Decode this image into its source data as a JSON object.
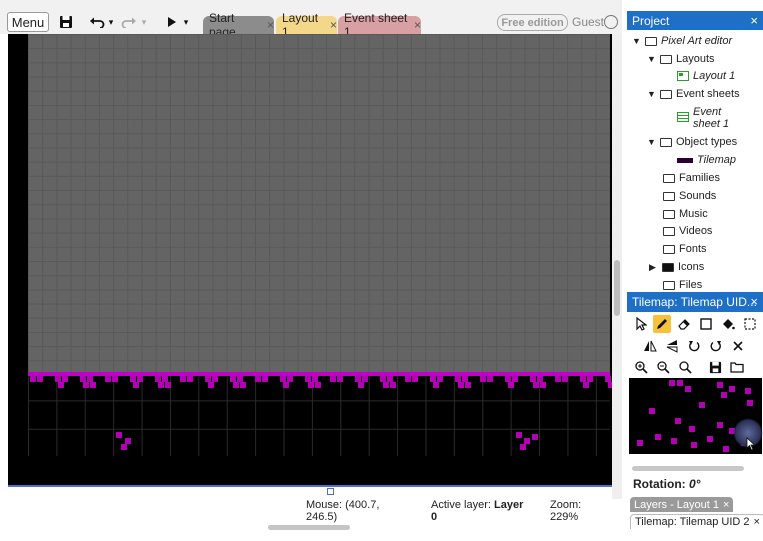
{
  "toolbar": {
    "menu_label": "Menu",
    "save_icon": "save-icon",
    "undo_icon": "undo-icon",
    "redo_icon": "redo-icon",
    "play_icon": "play-icon",
    "dropdown_glyph": "▾",
    "tabs": [
      {
        "label": "Start page",
        "close": "×",
        "color": "#8c8c8c"
      },
      {
        "label": "Layout 1",
        "close": "×",
        "color": "#f3d78a"
      },
      {
        "label": "Event sheet 1",
        "close": "×",
        "color": "#d9a0a4"
      }
    ],
    "edition_badge": "Free edition",
    "user": "Guest"
  },
  "status": {
    "mouse": "Mouse: (400.7, 246.5)",
    "active_layer_label": "Active layer:",
    "active_layer_value": "Layer 0",
    "zoom": "Zoom: 229%"
  },
  "project_panel": {
    "title": "Project",
    "close": "×",
    "tree": [
      {
        "label": "Pixel Art editor",
        "expanded": true,
        "italic": true
      },
      {
        "label": "Layouts",
        "expanded": true
      },
      {
        "label": "Layout 1",
        "italic": true
      },
      {
        "label": "Event sheets",
        "expanded": true
      },
      {
        "label": "Event sheet 1",
        "italic": true
      },
      {
        "label": "Object types",
        "expanded": true
      },
      {
        "label": "Tilemap",
        "italic": true
      },
      {
        "label": "Families"
      },
      {
        "label": "Sounds"
      },
      {
        "label": "Music"
      },
      {
        "label": "Videos"
      },
      {
        "label": "Fonts"
      },
      {
        "label": "Icons",
        "expanded": false
      },
      {
        "label": "Files"
      }
    ]
  },
  "tilemap_panel": {
    "title": "Tilemap: Tilemap UID...",
    "close": "×",
    "tools_row1": [
      "arrow-icon",
      "pencil-icon",
      "eraser-icon",
      "rectangle-icon",
      "fill-icon",
      "marquee-icon"
    ],
    "tools_row2": [
      "mirror-icon",
      "flip-icon",
      "rotate-ccw-icon",
      "rotate-cw-icon",
      "cross-icon"
    ],
    "tools_row3": [
      "zoom-in-icon",
      "zoom-out-icon",
      "zoom-reset-icon",
      "save-icon",
      "folder-icon"
    ],
    "active_tool": "pencil-icon",
    "rotation_label": "Rotation:",
    "rotation_value": "0°"
  },
  "bottom_tabs": [
    {
      "label": "Layers - Layout 1",
      "close": "×"
    },
    {
      "label": "Tilemap: Tilemap UID 2",
      "close": "×"
    }
  ],
  "colors": {
    "accent": "#1e70c6",
    "tile": "#b400b4",
    "active_tool": "#f5c23a"
  }
}
